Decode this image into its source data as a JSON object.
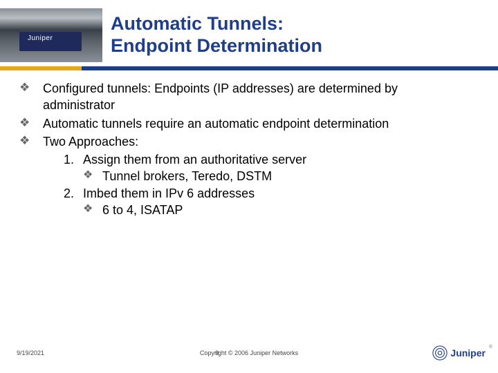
{
  "colors": {
    "title": "#1f3e89",
    "accent_gold": "#e6a817",
    "accent_blue": "#1f3e89",
    "bullet": "#666666"
  },
  "header": {
    "image_label": "Juniper",
    "title_line1": "Automatic Tunnels:",
    "title_line2": "Endpoint Determination"
  },
  "bullets": [
    "Configured tunnels: Endpoints (IP addresses) are determined by administrator",
    "Automatic tunnels require an automatic endpoint determination",
    "Two Approaches:"
  ],
  "approaches": [
    {
      "num": "1.",
      "text": "Assign them from an authoritative server",
      "sub": "Tunnel brokers, Teredo, DSTM"
    },
    {
      "num": "2.",
      "text": "Imbed them in IPv 6 addresses",
      "sub": "6 to 4, ISATAP"
    }
  ],
  "footer": {
    "date": "9/19/2021",
    "copyright": "Copyright © 2006 Juniper Networks",
    "page": "9",
    "logo_text": "Juniper"
  }
}
